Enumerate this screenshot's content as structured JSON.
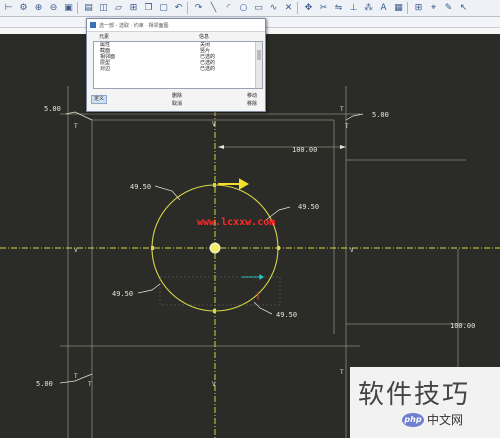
{
  "toolbar": {
    "icons": [
      {
        "name": "dimension-tool-icon",
        "glyph": "⊢"
      },
      {
        "name": "settings-icon",
        "glyph": "⚙"
      },
      {
        "name": "zoom-in-icon",
        "glyph": "⊕"
      },
      {
        "name": "zoom-out-icon",
        "glyph": "⊖"
      },
      {
        "name": "repaint-icon",
        "glyph": "▣"
      },
      {
        "name": "named-view-icon",
        "glyph": "▤"
      },
      {
        "name": "layer-icon",
        "glyph": "◫"
      },
      {
        "name": "datum-plane-icon",
        "glyph": "▱"
      },
      {
        "name": "orient-icon",
        "glyph": "⊞"
      },
      {
        "name": "copy-icon",
        "glyph": "❐"
      },
      {
        "name": "paste-icon",
        "glyph": "▢"
      },
      {
        "name": "undo-icon",
        "glyph": "↶"
      },
      {
        "name": "redo-icon",
        "glyph": "↷"
      },
      {
        "name": "line-tool-icon",
        "glyph": "╲"
      },
      {
        "name": "arc-tool-icon",
        "glyph": "◜"
      },
      {
        "name": "circle-tool-icon",
        "glyph": "○"
      },
      {
        "name": "rectangle-tool-icon",
        "glyph": "▭"
      },
      {
        "name": "spline-tool-icon",
        "glyph": "∿"
      },
      {
        "name": "point-tool-icon",
        "glyph": "✕"
      },
      {
        "name": "move-icon",
        "glyph": "✥"
      },
      {
        "name": "trim-icon",
        "glyph": "✂"
      },
      {
        "name": "mirror-icon",
        "glyph": "⇋"
      },
      {
        "name": "constraint-icon",
        "glyph": "⊥"
      },
      {
        "name": "array-icon",
        "glyph": "⁂"
      },
      {
        "name": "text-icon",
        "glyph": "A"
      },
      {
        "name": "palette-icon",
        "glyph": "▦"
      },
      {
        "name": "grid-icon",
        "glyph": "⊞"
      },
      {
        "name": "analysis-icon",
        "glyph": "⌖"
      },
      {
        "name": "note-icon",
        "glyph": "✎"
      },
      {
        "name": "pointer-icon",
        "glyph": "↖"
      }
    ]
  },
  "dialog": {
    "title": "选一部 - 选取 · 约束 · 相邻面图",
    "columns": [
      "元素",
      "信息"
    ],
    "rows": [
      {
        "c1": "属性",
        "c2": "关闭"
      },
      {
        "c1": "截面",
        "c2": "竖片"
      },
      {
        "c1": "相邻面",
        "c2": "已选的"
      },
      {
        "c1": "层型",
        "c2": "已选的"
      },
      {
        "c1": "对边",
        "c2": "已选的"
      }
    ],
    "buttons": {
      "select": "定义",
      "delete": "删除",
      "cancel": "取消",
      "move": "移动",
      "remove": "移除"
    }
  },
  "drawing": {
    "dims": {
      "left_top": "5.00",
      "right_top": "5.00",
      "left_bottom": "5.00",
      "horizontal": "100.00",
      "vertical": "100.00",
      "radius_top_left": "49.50",
      "radius_top_right": "49.50",
      "radius_bottom_left": "49.50",
      "radius_bottom_right": "49.50"
    },
    "watermark": "www.lcxxw.com",
    "colors": {
      "background": "#2b2b27",
      "sketch": "#d8d64a",
      "dimension": "#e6e6d9",
      "frame": "#8a8a7a"
    }
  },
  "corner_watermark": {
    "title": "软件技巧",
    "logo": "php",
    "site": "中文网"
  }
}
